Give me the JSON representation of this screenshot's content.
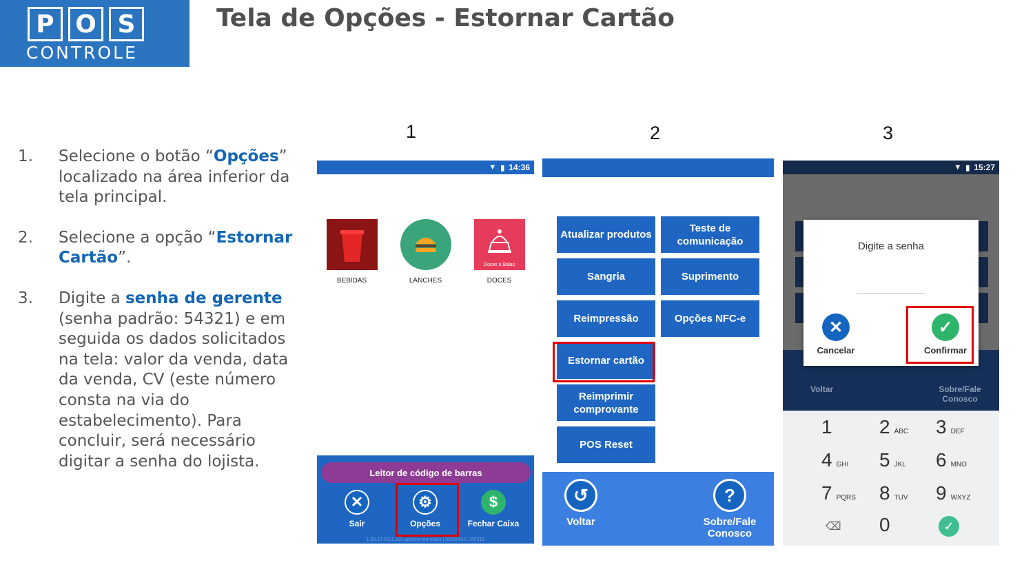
{
  "logo": {
    "letters": [
      "P",
      "O",
      "S"
    ],
    "subtitle": "CONTROLE"
  },
  "title": "Tela de Opções - Estornar Cartão",
  "steps": [
    {
      "num": "1.",
      "pre": "Selecione o botão “",
      "hl": "Opções",
      "post": "” localizado na área inferior da tela principal."
    },
    {
      "num": "2.",
      "pre": "Selecione a opção “",
      "hl": "Estornar Cartão",
      "post": "”."
    },
    {
      "num": "3.",
      "pre": "Digite a ",
      "hl": "senha de gerente",
      "post": " (senha padrão: 54321) e em seguida os dados solicitados na tela: valor da venda, data da venda, CV (este número consta na via do estabelecimento). Para concluir, será necessário digitar a senha do lojista."
    }
  ],
  "step_labels": [
    "1",
    "2",
    "3"
  ],
  "screen1": {
    "time": "14:36",
    "categories": [
      {
        "label": "BEBIDAS",
        "icon": "cup-icon"
      },
      {
        "label": "LANCHES",
        "icon": "burger-icon"
      },
      {
        "label": "DOCES",
        "icon": "cake-icon",
        "caption": "Doces e Balas"
      }
    ],
    "barcode_label": "Leitor de código de barras",
    "buttons": [
      {
        "label": "Sair",
        "icon": "close-icon"
      },
      {
        "label": "Opções",
        "icon": "gear-icon"
      },
      {
        "label": "Fechar Caixa",
        "icon": "dollar-icon"
      }
    ],
    "version": "1.20.17-RC1.320 garcom-simulado | 00000010 | AF515"
  },
  "screen2": {
    "menu": [
      "Atualizar produtos",
      "Teste de comunicação",
      "Sangria",
      "Suprimento",
      "Reimpressão",
      "Opções NFC-e",
      "Estornar cartão",
      "Reimprimir comprovante",
      "POS Reset"
    ],
    "back_label": "Voltar",
    "about_label": "Sobre/Fale Conosco"
  },
  "screen3": {
    "time": "15:27",
    "prompt": "Digite a senha",
    "cancel_label": "Cancelar",
    "confirm_label": "Confirmar",
    "bg_back": "Voltar",
    "bg_about": "Sobre/Fale Conosco",
    "keys": [
      {
        "d": "1",
        "l": ""
      },
      {
        "d": "2",
        "l": "ABC"
      },
      {
        "d": "3",
        "l": "DEF"
      },
      {
        "d": "4",
        "l": "GHI"
      },
      {
        "d": "5",
        "l": "JKL"
      },
      {
        "d": "6",
        "l": "MNO"
      },
      {
        "d": "7",
        "l": "PQRS"
      },
      {
        "d": "8",
        "l": "TUV"
      },
      {
        "d": "9",
        "l": "WXYZ"
      },
      {
        "d": "0",
        "l": ""
      }
    ]
  },
  "colors": {
    "brand_blue": "#2a74c0",
    "app_blue": "#1f66c2",
    "highlight": "#e00000",
    "accent_text": "#1266b3"
  }
}
